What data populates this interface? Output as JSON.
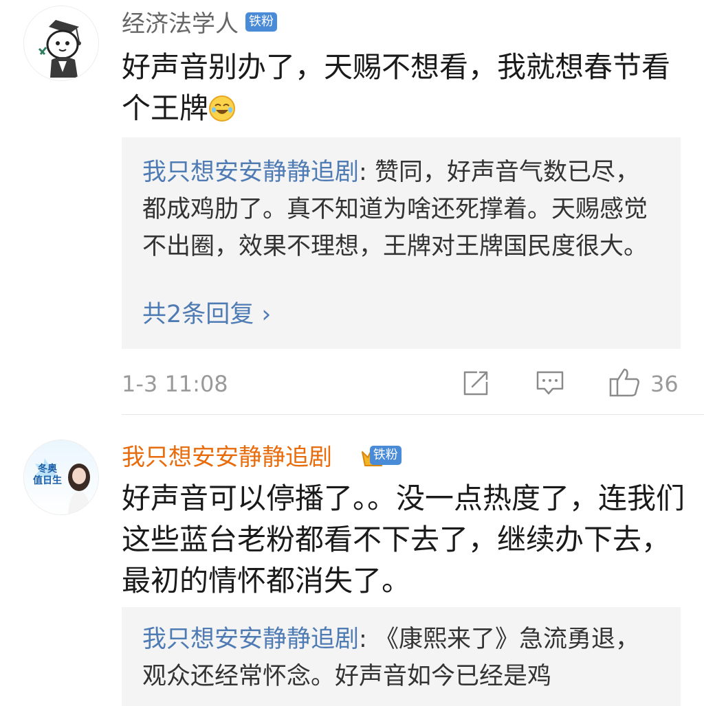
{
  "comments": [
    {
      "username": "经济法学人",
      "badge": "铁粉",
      "text": "好声音别办了，天赐不想看，我就想春节看个王牌",
      "reply": {
        "user": "我只想安安静静追剧",
        "sep": ":",
        "text": " 赞同，好声音气数已尽，都成鸡肋了。真不知道为啥还死撑着。天赐感觉不出圈，效果不理想，王牌对王牌国民度很大。"
      },
      "more_replies": "共2条回复 ›",
      "time": "1-3 11:08",
      "like_count": "36"
    },
    {
      "username": "我只想安安静静追剧",
      "badge": "铁粉",
      "avatar_text": "冬奥\n值日生",
      "text": "好声音可以停播了。。没一点热度了，连我们这些蓝台老粉都看不下去了，继续办下去，最初的情怀都消失了。",
      "reply": {
        "user": "我只想安安静静追剧",
        "sep": ":",
        "text": " 《康熙来了》急流勇退，观众还经常怀念。好声音如今已经是鸡"
      }
    }
  ],
  "colors": {
    "link_blue": "#4e7bb3",
    "vip_orange": "#e86b0c",
    "badge_blue": "#4a8bd8",
    "reply_bg": "#f4f4f4"
  }
}
